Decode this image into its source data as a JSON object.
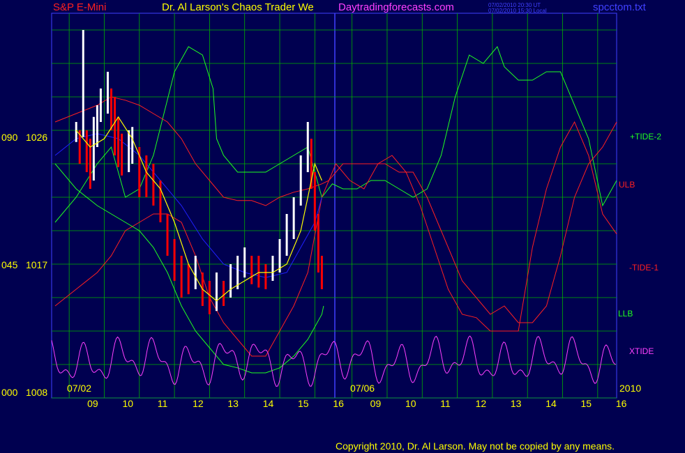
{
  "header": {
    "instrument": "S&P E-Mini",
    "title": "Dr. Al Larson's Chaos Trader We",
    "site": "Daytradingforecasts.com",
    "timestamp_ut": "07/02/2010 20:30 UT",
    "timestamp_local": "07/02/2010 15:30 Local",
    "file": "spcctom.txt"
  },
  "copyright": "Copyright 2010, Dr. Al Larson. May not be copied by any means.",
  "colors": {
    "background": "#000050",
    "grid": "#00b000",
    "price_up": "#ffffff",
    "price_down": "#ff0000",
    "tide2": "#20ff20",
    "tide1": "#ff2020",
    "xtide": "#ff40ff",
    "moving_average": "#ffff00",
    "blue_line": "#2020ff",
    "text": "#ffff00"
  },
  "chart_data": {
    "type": "line",
    "title": "S&P E-Mini",
    "yaxis_labels": [
      {
        "left": "090",
        "right": "1026",
        "value": 1026
      },
      {
        "left": "045",
        "right": "1017",
        "value": 1017
      },
      {
        "left": "000",
        "right": "1008",
        "value": 1008
      }
    ],
    "ylim": [
      1008,
      1031
    ],
    "date_labels": [
      "07/02",
      "07/06",
      "2010"
    ],
    "x_ticks": [
      "09",
      "10",
      "11",
      "12",
      "13",
      "14",
      "15",
      "16",
      "09",
      "10",
      "11",
      "12",
      "13",
      "14",
      "15",
      "16"
    ],
    "series_labels": [
      {
        "name": "+TIDE-2",
        "color": "#20ff20"
      },
      {
        "name": "ULB",
        "color": "#ff2020"
      },
      {
        "name": "-TIDE-1",
        "color": "#ff2020"
      },
      {
        "name": "LLB",
        "color": "#20ff20"
      },
      {
        "name": "XTIDE",
        "color": "#ff40ff"
      }
    ],
    "price_bars": [
      [
        8.0,
        1024.5,
        1023.3
      ],
      [
        8.1,
        1024.0,
        1022.0
      ],
      [
        8.2,
        1030.0,
        1023.6
      ],
      [
        8.3,
        1024.0,
        1021.5
      ],
      [
        8.4,
        1023.5,
        1020.5
      ],
      [
        8.5,
        1024.8,
        1021.0
      ],
      [
        8.6,
        1025.5,
        1023.0
      ],
      [
        8.7,
        1026.5,
        1024.5
      ],
      [
        8.9,
        1027.5,
        1025.0
      ],
      [
        9.0,
        1026.5,
        1024.0
      ],
      [
        9.1,
        1026.0,
        1022.5
      ],
      [
        9.2,
        1024.8,
        1021.8
      ],
      [
        9.3,
        1023.8,
        1021.3
      ],
      [
        9.5,
        1024.0,
        1021.5
      ],
      [
        9.6,
        1024.2,
        1022.0
      ],
      [
        9.8,
        1023.0,
        1020.0
      ],
      [
        10.0,
        1022.5,
        1020.0
      ],
      [
        10.2,
        1022.0,
        1019.5
      ],
      [
        10.4,
        1021.0,
        1018.5
      ],
      [
        10.6,
        1019.0,
        1016.5
      ],
      [
        10.8,
        1017.5,
        1015.0
      ],
      [
        11.0,
        1016.5,
        1014.0
      ],
      [
        11.2,
        1016.0,
        1014.2
      ],
      [
        11.4,
        1016.5,
        1014.5
      ],
      [
        11.6,
        1015.5,
        1013.5
      ],
      [
        11.8,
        1015.0,
        1013.0
      ],
      [
        12.0,
        1015.5,
        1013.2
      ],
      [
        12.2,
        1015.0,
        1013.5
      ],
      [
        12.4,
        1016.0,
        1014.0
      ],
      [
        12.6,
        1016.5,
        1014.5
      ],
      [
        12.8,
        1017.0,
        1015.2
      ],
      [
        13.0,
        1016.5,
        1014.8
      ],
      [
        13.2,
        1016.5,
        1014.6
      ],
      [
        13.4,
        1016.0,
        1014.5
      ],
      [
        13.6,
        1016.5,
        1015.0
      ],
      [
        13.8,
        1017.5,
        1015.5
      ],
      [
        14.0,
        1019.0,
        1016.5
      ],
      [
        14.2,
        1020.0,
        1017.5
      ],
      [
        14.4,
        1022.5,
        1019.5
      ],
      [
        14.6,
        1024.5,
        1021.5
      ],
      [
        14.7,
        1023.5,
        1020.5
      ],
      [
        14.8,
        1021.5,
        1018.0
      ],
      [
        14.9,
        1019.0,
        1015.5
      ],
      [
        15.0,
        1016.5,
        1014.5
      ]
    ],
    "series": [
      {
        "name": "+TIDE-2",
        "x": [
          7.4,
          8.0,
          8.6,
          9.0,
          9.4,
          9.8,
          10.2,
          10.5,
          10.8,
          11.2,
          11.6,
          11.9,
          12.0,
          12.2,
          12.6,
          13.0,
          13.4,
          13.8,
          14.2,
          14.6,
          15.0,
          15.3,
          15.6,
          16.0,
          16.4,
          16.8,
          17.2,
          17.6,
          18.0,
          18.4,
          18.8,
          19.2,
          19.6,
          20.0,
          20.2,
          20.6,
          21.0,
          21.4,
          21.8,
          22.2,
          22.6,
          23.0,
          23.4
        ],
        "y": [
          1018.5,
          1020.0,
          1022.0,
          1023.0,
          1020.0,
          1020.5,
          1022.5,
          1025.0,
          1027.5,
          1029.0,
          1028.5,
          1026.5,
          1023.5,
          1022.5,
          1021.5,
          1021.5,
          1021.5,
          1022.0,
          1022.5,
          1023.0,
          1020.0,
          1020.8,
          1020.5,
          1020.5,
          1021.0,
          1021.0,
          1020.5,
          1020.0,
          1020.5,
          1022.5,
          1026.0,
          1028.5,
          1028.0,
          1029.0,
          1027.8,
          1027.0,
          1027.0,
          1027.5,
          1027.5,
          1025.5,
          1023.5,
          1019.5,
          1021.0
        ]
      },
      {
        "name": "ULB",
        "x": [
          7.4,
          8.0,
          8.6,
          9.0,
          9.4,
          9.8,
          10.2,
          10.6,
          11.0,
          11.4,
          11.8,
          12.2,
          12.6,
          13.0,
          13.4,
          13.8,
          14.2,
          14.6,
          15.0,
          15.2,
          15.6,
          16.0,
          16.4,
          16.8,
          17.2,
          17.6,
          18.0,
          18.4,
          18.8,
          19.0,
          19.4,
          19.8,
          20.2,
          20.6,
          21.0,
          21.4,
          21.8,
          22.2,
          22.6,
          23.0,
          23.4
        ],
        "y": [
          1024.5,
          1025.0,
          1025.5,
          1026.0,
          1025.8,
          1025.5,
          1025.0,
          1024.5,
          1023.5,
          1022.0,
          1021.0,
          1020.0,
          1019.8,
          1019.8,
          1019.5,
          1020.0,
          1020.3,
          1020.5,
          1020.8,
          1021.0,
          1022.0,
          1022.0,
          1022.0,
          1022.0,
          1021.5,
          1021.5,
          1020.0,
          1018.0,
          1016.0,
          1015.0,
          1014.0,
          1013.0,
          1013.5,
          1012.5,
          1012.5,
          1013.5,
          1016.5,
          1020.0,
          1022.0,
          1023.0,
          1024.5
        ]
      },
      {
        "name": "-TIDE-1",
        "x": [
          7.4,
          8.0,
          8.6,
          9.0,
          9.4,
          9.8,
          10.2,
          10.6,
          11.0,
          11.4,
          11.8,
          12.2,
          12.6,
          13.0,
          13.4,
          13.8,
          14.2,
          14.6,
          15.0,
          15.4,
          15.8,
          16.2,
          16.6,
          17.0,
          17.4,
          17.8,
          18.2,
          18.6,
          19.0,
          19.4,
          19.8,
          20.2,
          20.6,
          21.0,
          21.4,
          21.8,
          22.2,
          22.6,
          23.0,
          23.4
        ],
        "y": [
          1013.5,
          1014.5,
          1015.5,
          1016.5,
          1018.0,
          1018.5,
          1019.0,
          1019.0,
          1018.5,
          1016.5,
          1014.0,
          1012.5,
          1011.5,
          1010.5,
          1010.5,
          1012.0,
          1013.5,
          1015.5,
          1020.0,
          1022.0,
          1021.0,
          1020.5,
          1022.0,
          1022.5,
          1021.5,
          1019.5,
          1017.0,
          1014.5,
          1013.0,
          1012.8,
          1012.0,
          1012.0,
          1012.0,
          1017.0,
          1020.5,
          1023.0,
          1024.5,
          1022.5,
          1019.0,
          1017.8
        ]
      },
      {
        "name": "LLB",
        "x": [
          7.4,
          8.0,
          8.6,
          9.0,
          9.4,
          9.8,
          10.2,
          10.6,
          11.0,
          11.4,
          11.8,
          12.2,
          12.6,
          13.0,
          13.4,
          13.8,
          14.2,
          14.6,
          15.0,
          15.05
        ],
        "y": [
          1022.0,
          1020.5,
          1019.5,
          1019.0,
          1018.5,
          1018.0,
          1017.0,
          1015.5,
          1013.5,
          1012.0,
          1011.0,
          1010.0,
          1009.8,
          1009.5,
          1009.5,
          1009.8,
          1010.5,
          1011.5,
          1013.0,
          1013.5
        ]
      },
      {
        "name": "XTIDE",
        "x": [],
        "y": []
      },
      {
        "name": "Average",
        "x": [
          8.0,
          8.4,
          8.8,
          9.2,
          9.6,
          10.0,
          10.4,
          10.8,
          11.2,
          11.6,
          12.0,
          12.4,
          12.8,
          13.2,
          13.6,
          14.0,
          14.4,
          14.6,
          14.8,
          15.0
        ],
        "y": [
          1024.0,
          1023.0,
          1023.5,
          1024.8,
          1023.5,
          1021.5,
          1020.5,
          1018.5,
          1016.0,
          1014.5,
          1013.8,
          1014.5,
          1015.0,
          1015.5,
          1015.5,
          1016.0,
          1018.0,
          1020.0,
          1022.0,
          1021.0
        ]
      },
      {
        "name": "Blue",
        "x": [
          7.4,
          8.0,
          8.6,
          9.2,
          9.8,
          10.4,
          11.0,
          11.6,
          12.2,
          12.8,
          13.4,
          14.0,
          14.4,
          14.8,
          15.0
        ],
        "y": [
          1022.5,
          1023.5,
          1023.8,
          1023.5,
          1022.5,
          1021.0,
          1019.5,
          1017.5,
          1016.0,
          1015.5,
          1015.2,
          1015.5,
          1017.0,
          1018.5,
          1020.0
        ]
      }
    ]
  }
}
